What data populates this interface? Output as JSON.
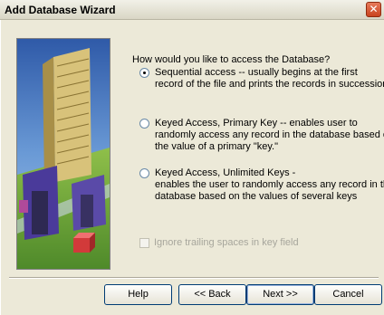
{
  "window": {
    "title": "Add Database Wizard",
    "close_symbol": "✕"
  },
  "question": "How would you like to access the Database?",
  "options": [
    {
      "checked": true,
      "lines": [
        "Sequential access -- usually begins at the first",
        "record of the file and prints the records in succession."
      ]
    },
    {
      "checked": false,
      "lines": [
        "Keyed Access, Primary Key -- enables user to",
        "randomly access any record in the database based on",
        "the value of a primary \"key.\""
      ]
    },
    {
      "checked": false,
      "lines": [
        "Keyed Access, Unlimited Keys -",
        "enables the user to randomly access any record in the",
        "database based on the values of several keys"
      ]
    }
  ],
  "ignore_trailing": {
    "label": "Ignore trailing spaces in key field",
    "enabled": false,
    "checked": false
  },
  "buttons": {
    "help": "Help",
    "back": "<< Back",
    "next": "Next >>",
    "cancel": "Cancel"
  },
  "icons": {
    "wizard_picture": "city-buildings-illustration",
    "close": "close-icon"
  },
  "colors": {
    "dialog_bg": "#ece9d8",
    "close_button": "#c9431f",
    "disabled_text": "#a7a69c"
  }
}
